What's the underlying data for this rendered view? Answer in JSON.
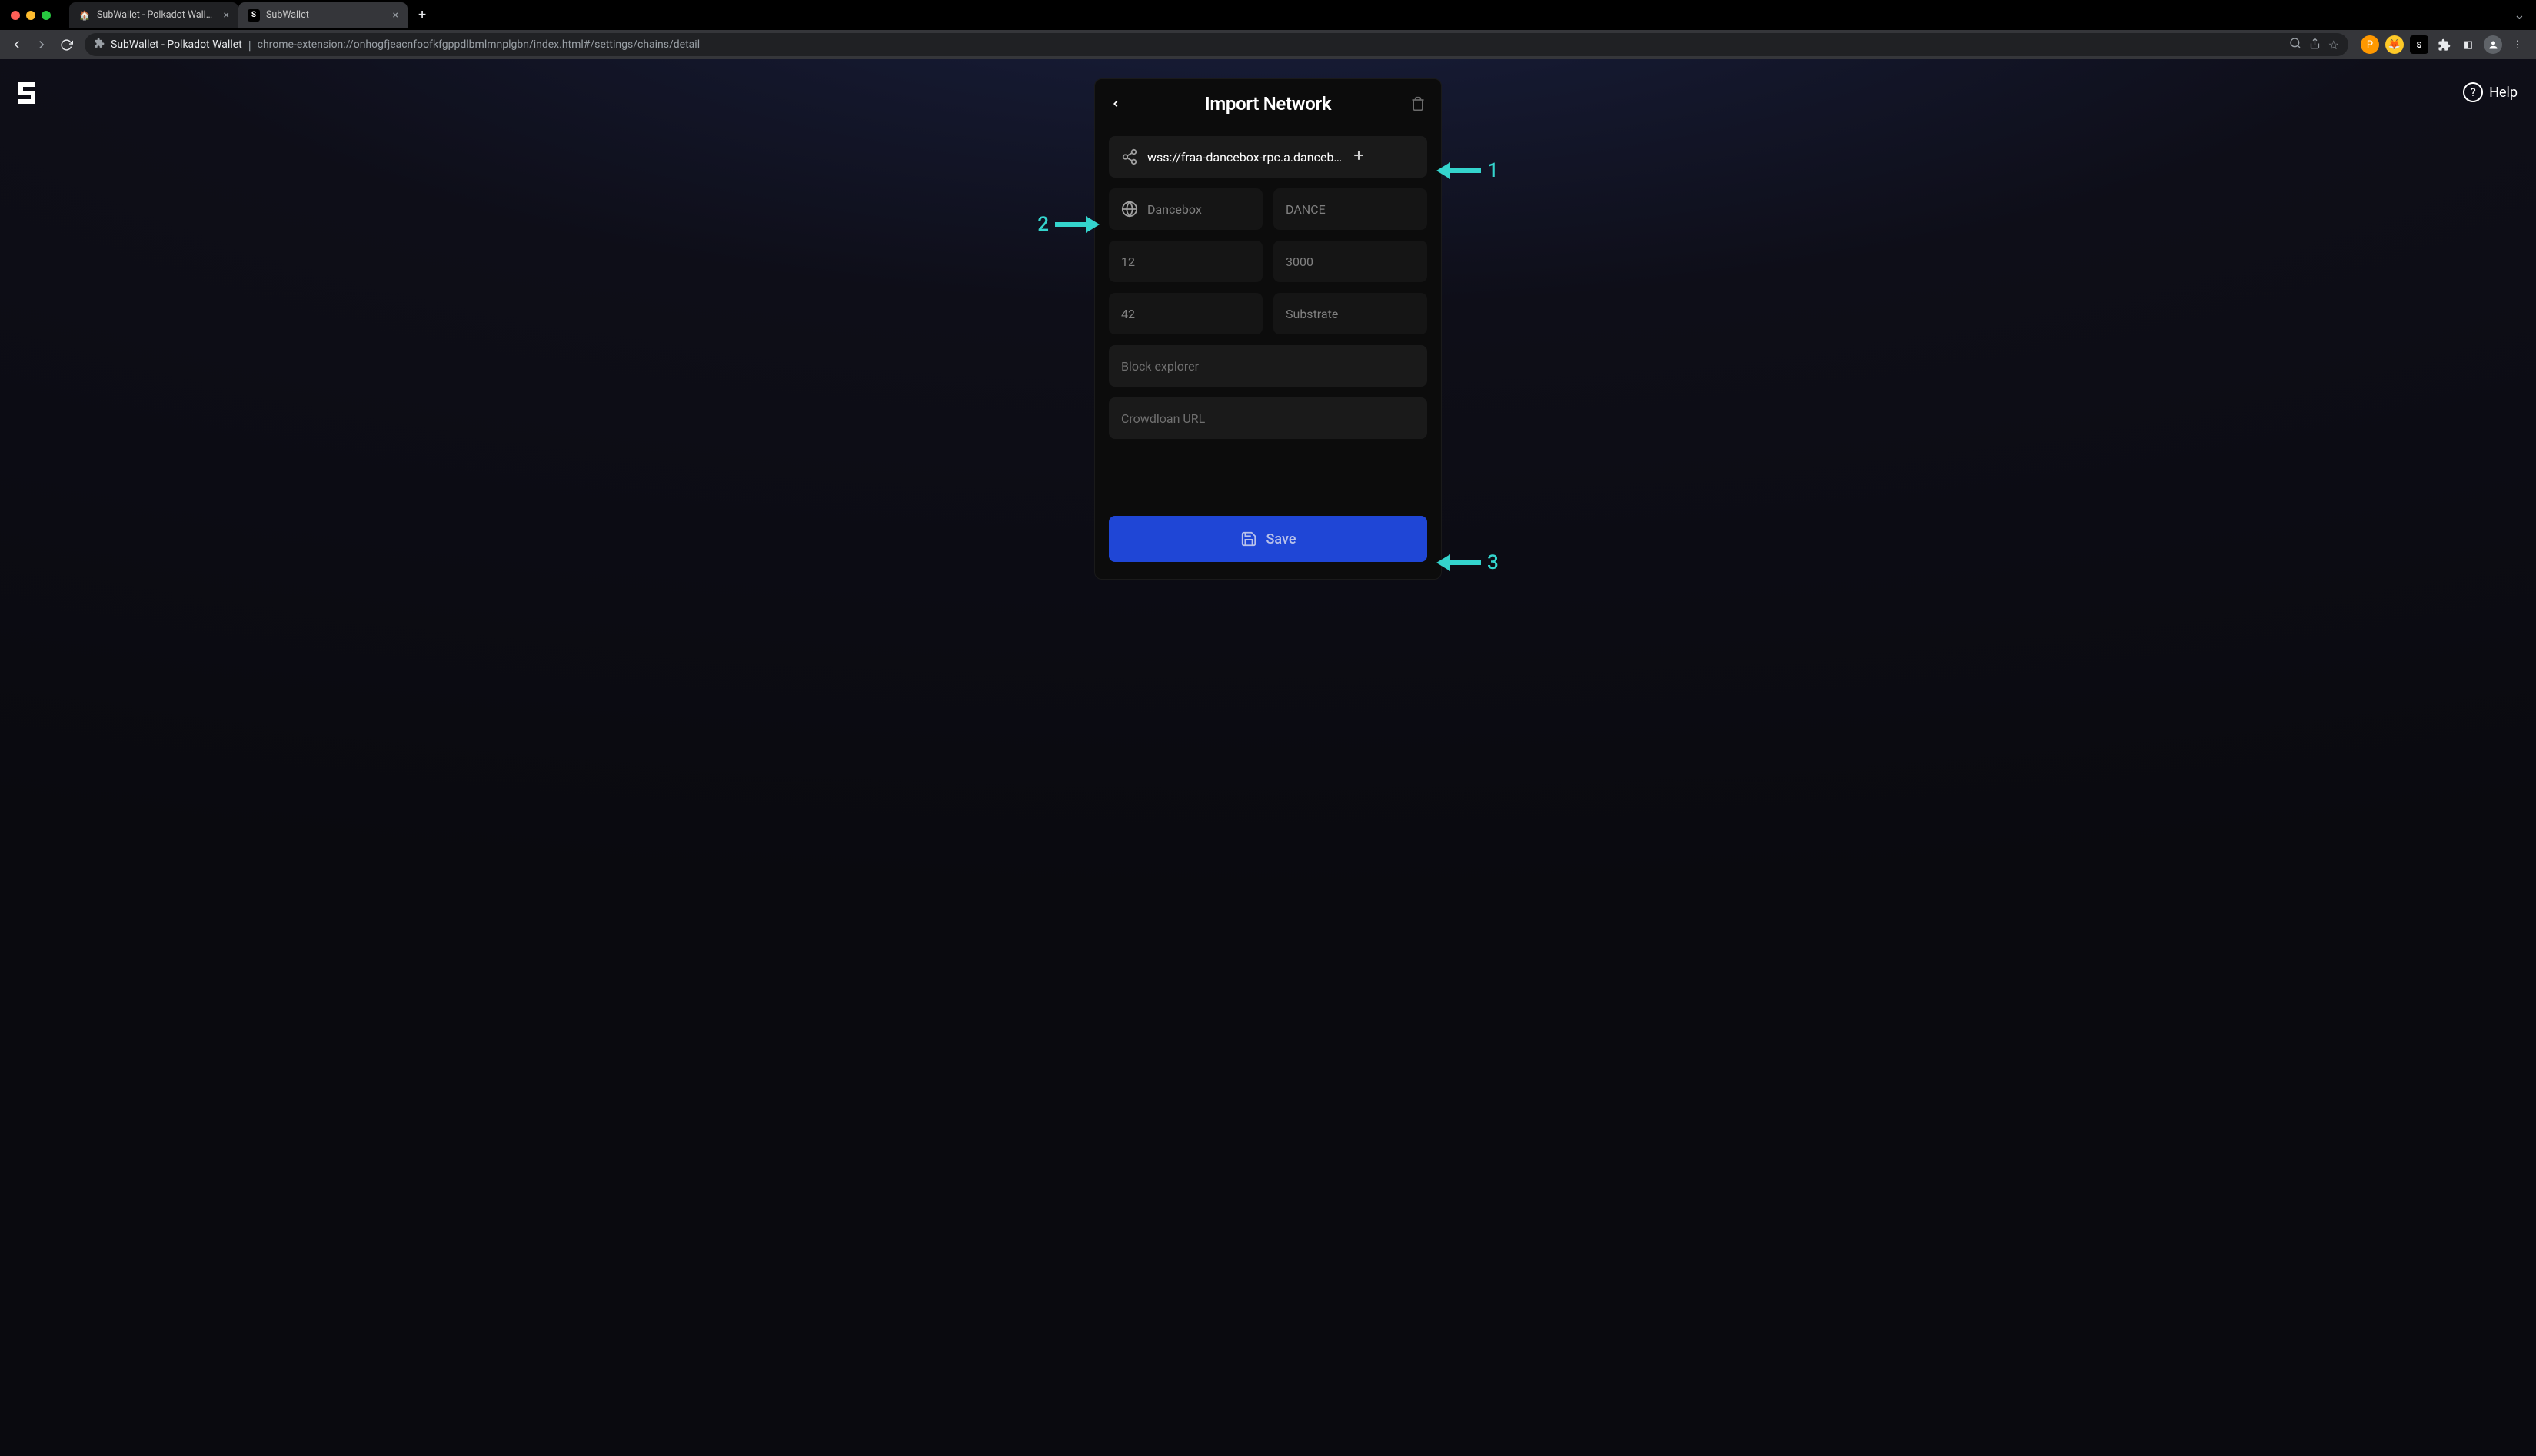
{
  "browser": {
    "tabs": [
      {
        "title": "SubWallet - Polkadot Wallet -",
        "favicon": "🏠",
        "active": false
      },
      {
        "title": "SubWallet",
        "favicon": "S",
        "active": true
      }
    ],
    "addressbar": {
      "app_title": "SubWallet - Polkadot Wallet",
      "url": "chrome-extension://onhogfjeacnfoofkfgppdlbmlmnplgbn/index.html#/settings/chains/detail"
    }
  },
  "app": {
    "help_label": "Help"
  },
  "modal": {
    "title": "Import Network",
    "provider_url": "wss://fraa-dancebox-rpc.a.danceb…",
    "chain_name": "Dancebox",
    "token_symbol": "DANCE",
    "decimals": "12",
    "chain_id": "3000",
    "prefix": "42",
    "chain_type": "Substrate",
    "block_explorer_placeholder": "Block explorer",
    "crowdloan_url_placeholder": "Crowdloan URL",
    "save_label": "Save"
  },
  "annotations": {
    "n1": "1",
    "n2": "2",
    "n3": "3"
  },
  "colors": {
    "accent_annotation": "#34d4cd",
    "primary_button": "#1f46d6"
  }
}
